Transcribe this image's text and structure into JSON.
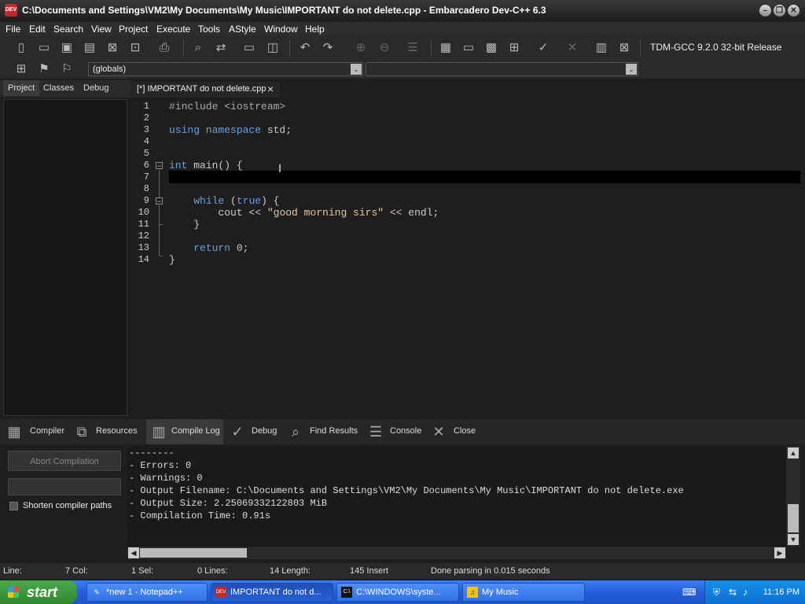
{
  "window": {
    "app_icon_text": "DEV",
    "title": "C:\\Documents and Settings\\VM2\\My Documents\\My Music\\IMPORTANT do not delete.cpp - Embarcadero Dev-C++ 6.3",
    "minimize": "–",
    "restore": "❐",
    "close": "✕"
  },
  "menu": [
    "File",
    "Edit",
    "Search",
    "View",
    "Project",
    "Execute",
    "Tools",
    "AStyle",
    "Window",
    "Help"
  ],
  "toolbar": {
    "compiler": "TDM-GCC 9.2.0 32-bit Release",
    "globals": "(globals)",
    "dropdown_arrow": "⌄"
  },
  "left_tabs": [
    "Project",
    "Classes",
    "Debug"
  ],
  "editor_tab": {
    "label": "[*] IMPORTANT do not delete.cpp",
    "close": "×"
  },
  "code": {
    "line_numbers": [
      "1",
      "2",
      "3",
      "4",
      "5",
      "6",
      "7",
      "8",
      "9",
      "10",
      "11",
      "12",
      "13",
      "14"
    ],
    "lines": [
      {
        "pp": "#include <iostream>"
      },
      {},
      {
        "kw": "using namespace",
        "rest": " std;"
      },
      {},
      {},
      {
        "kw": "int",
        "rest": " main() {"
      },
      {},
      {},
      {
        "indent": "    ",
        "kw": "while",
        "rest": " (",
        "kw2": "true",
        "rest2": ") {"
      },
      {
        "indent": "        ",
        "pre": "cout << ",
        "str": "\"good morning sirs\"",
        "rest": " << endl;"
      },
      {
        "indent": "    ",
        "pre": "}"
      },
      {},
      {
        "indent": "    ",
        "kw": "return",
        "rest": " 0;"
      },
      {
        "pre": "}"
      }
    ],
    "fold_symbol": "−"
  },
  "bottom_tabs": [
    "Compiler",
    "Resources",
    "Compile Log",
    "Debug",
    "Find Results",
    "Console",
    "Close"
  ],
  "compile_panel": {
    "abort_button": "Abort Compilation",
    "shorten_paths": "Shorten compiler paths",
    "log": [
      "--------",
      "- Errors: 0",
      "- Warnings: 0",
      "- Output Filename: C:\\Documents and Settings\\VM2\\My Documents\\My Music\\IMPORTANT do not delete.exe",
      "- Output Size: 2.25069332122803 MiB",
      "- Compilation Time: 0.91s"
    ]
  },
  "scroll_arrows": {
    "up": "▲",
    "down": "▼",
    "left": "◀",
    "right": "▶"
  },
  "status": {
    "line": "Line:",
    "col": "7 Col:",
    "sel": "1 Sel:",
    "lines": "0 Lines:",
    "length": "14 Length:",
    "insert": "145 Insert",
    "message": "Done parsing in 0.015 seconds"
  },
  "taskbar": {
    "start": "start",
    "tasks": [
      {
        "label": "*new 1 - Notepad++",
        "icon": "✎"
      },
      {
        "label": "IMPORTANT do not d...",
        "icon": "DEV"
      },
      {
        "label": "C:\\WINDOWS\\syste...",
        "icon": "C:\\"
      },
      {
        "label": "My Music",
        "icon": "♫"
      }
    ],
    "clock": "11:16 PM"
  }
}
